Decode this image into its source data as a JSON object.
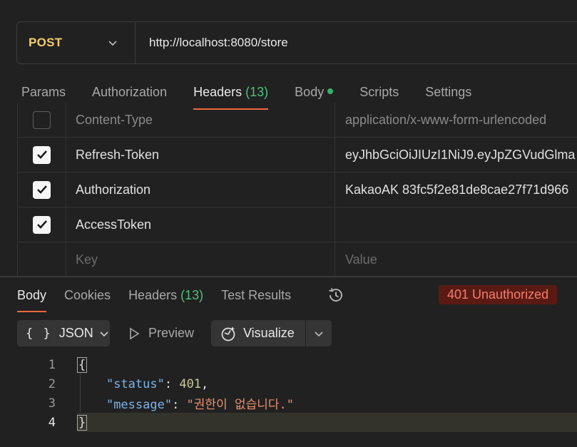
{
  "request": {
    "method": "POST",
    "url": "http://localhost:8080/store"
  },
  "request_tabs": [
    {
      "label": "Params",
      "count": "",
      "active": false
    },
    {
      "label": "Authorization",
      "count": "",
      "active": false
    },
    {
      "label": "Headers",
      "count": "(13)",
      "active": true
    },
    {
      "label": "Body",
      "count": "",
      "active": false,
      "dot": true
    },
    {
      "label": "Scripts",
      "count": "",
      "active": false
    },
    {
      "label": "Settings",
      "count": "",
      "active": false
    }
  ],
  "headers": [
    {
      "checked": false,
      "key": "Content-Type",
      "value": "application/x-www-form-urlencoded"
    },
    {
      "checked": true,
      "key": "Refresh-Token",
      "value": "eyJhbGciOiJIUzI1NiJ9.eyJpZGVudGlma"
    },
    {
      "checked": true,
      "key": "Authorization",
      "value": "KakaoAK 83fc5f2e81de8cae27f71d966"
    },
    {
      "checked": true,
      "key": "AccessToken",
      "value": ""
    }
  ],
  "headers_placeholder": {
    "key": "Key",
    "value": "Value"
  },
  "response_tabs": [
    {
      "label": "Body",
      "count": "",
      "active": true
    },
    {
      "label": "Cookies",
      "count": "",
      "active": false
    },
    {
      "label": "Headers",
      "count": "(13)",
      "active": false
    },
    {
      "label": "Test Results",
      "count": "",
      "active": false
    }
  ],
  "status": "401 Unauthorized",
  "colors": {
    "status_bg": "#5a1a14",
    "status_text": "#f27d6b",
    "accent": "#f0683c",
    "method": "#f4cc68"
  },
  "toolbar": {
    "format_icon": "{ }",
    "format": "JSON",
    "preview": "Preview",
    "visualize": "Visualize"
  },
  "code": {
    "line_numbers": [
      "1",
      "2",
      "3",
      "4"
    ],
    "open_brace": "{",
    "status_key": "\"status\"",
    "status_value": "401",
    "message_key": "\"message\"",
    "message_value": "\"권한이 없습니다.\"",
    "close_brace": "}"
  }
}
